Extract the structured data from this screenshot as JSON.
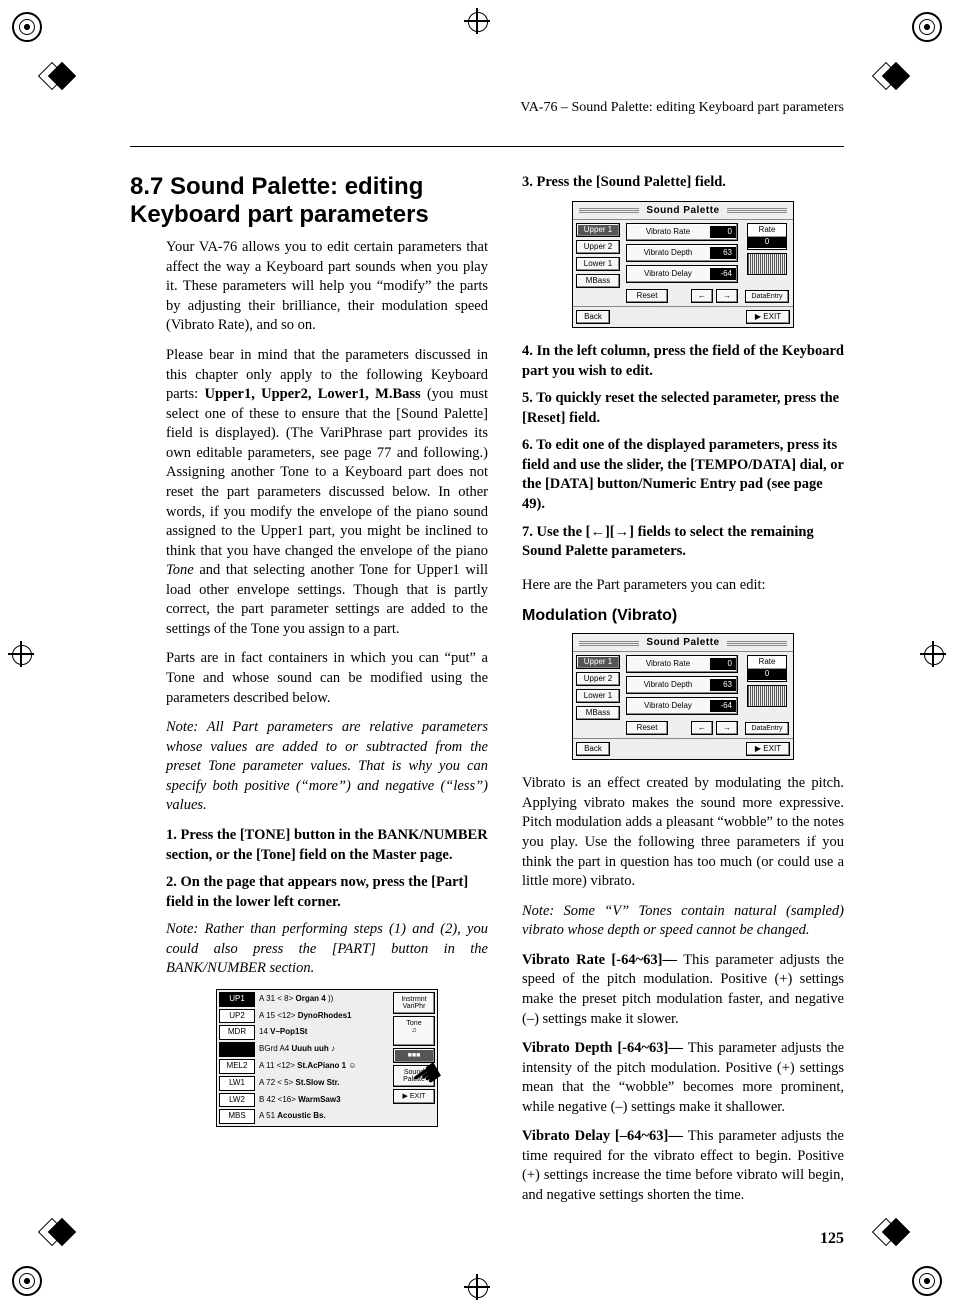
{
  "running_head": "VA-76 – Sound Palette: editing Keyboard part parameters",
  "page_number": "125",
  "heading": "8.7 Sound Palette: editing Keyboard part parameters",
  "para_intro": "Your VA-76 allows you to edit certain parameters that affect the way a Keyboard part sounds when you play it. These parameters will help you “modify” the parts by adjusting their brilliance, their modulation speed (Vibrato Rate), and so on.",
  "para_bear_pre": "Please bear in mind that the parameters discussed in this chapter only apply to the following Keyboard parts: ",
  "bold_parts": "Upper1, Upper2, Lower1, M.Bass",
  "para_bear_post": " (you must select one of these to ensure that the [Sound Palette] field is displayed). (The VariPhrase part provides its own editable parameters, see page 77 and following.) Assigning another Tone to a Keyboard part does not reset the part parameters discussed below. In other words, if you modify the envelope of the piano sound assigned to the Upper1 part, you might be inclined to think that you have changed the envelope of the piano ",
  "italic_tone": "Tone",
  "para_bear_post2": " and that selecting another Tone for Upper1 will load other envelope settings. Though that is partly correct, the part parameter settings are added to the settings of the Tone you assign to a part.",
  "para_parts": "Parts are in fact containers in which you can “put” a Tone and whose sound can be modified using the parameters described below.",
  "note_relative": "Note: All Part parameters are relative parameters whose values are added to or subtracted from the preset Tone parameter values. That is why you can specify both positive (“more”) and negative (“less”) values.",
  "step1": "1. Press the [TONE] button in the BANK/NUMBER section, or the [Tone] field on the Master page.",
  "step2": "2. On the page that appears now, press the [Part] field in the lower left corner.",
  "note_steps12": "Note: Rather than performing steps (1) and (2), you could also press the [PART] button in the BANK/NUMBER section.",
  "step3": "3. Press the [Sound Palette] field.",
  "step4": "4. In the left column, press the field of the Keyboard part you wish to edit.",
  "step5": "5. To quickly reset the selected parameter, press the [Reset] field.",
  "step6": "6. To edit one of the displayed parameters, press its field and use the slider, the [TEMPO/DATA] dial, or the [DATA] button/Numeric Entry pad (see page 49).",
  "step7_pre": "7. Use the [",
  "step7_mid": "][",
  "step7_post": "] fields to select the remaining Sound Palette parameters.",
  "left_arrow": "←",
  "right_arrow": "→",
  "para_here": "Here are the Part parameters you can edit:",
  "subhead_mod": "Modulation (Vibrato)",
  "para_vibrato": "Vibrato is an effect created by modulating the pitch. Applying vibrato makes the sound more expressive. Pitch modulation adds a pleasant “wobble” to the notes you play. Use the following three parameters if you think the part in question has too much (or could use a little more) vibrato.",
  "note_vtones": "Note: Some “V” Tones contain natural (sampled) vibrato whose depth or speed cannot be changed.",
  "vr_name": "Vibrato Rate [-64~63]— ",
  "vr_body": "This parameter adjusts the speed of the pitch modulation. Positive (+) settings make the preset pitch modulation faster, and negative (–) settings make it slower.",
  "vd_name": "Vibrato Depth [-64~63]— ",
  "vd_body": "This parameter adjusts the intensity of the pitch modulation. Positive (+) settings mean that the “wobble” becomes more prominent, while negative (–) settings make it shallower.",
  "vdel_name": "Vibrato Delay [–64~63]— ",
  "vdel_body": "This parameter adjusts the time required for the vibrato effect to begin. Positive (+) settings increase the time before vibrato will begin, and negative settings shorten the time.",
  "lcd": {
    "title": "Sound  Palette",
    "side": {
      "u1": "Upper 1",
      "u2": "Upper 2",
      "l1": "Lower 1",
      "mb": "MBass"
    },
    "params": {
      "rate_lbl": "Vibrato Rate",
      "rate_val": "0",
      "depth_lbl": "Vibrato Depth",
      "depth_val": "63",
      "delay_lbl": "Vibrato Delay",
      "delay_val": "-64"
    },
    "reset": "Reset",
    "left": "←",
    "right": "→",
    "rate_caption": "Rate",
    "rate_num": "0",
    "dataentry": "DataEntry",
    "back": "Back",
    "exit": "▶ EXIT"
  },
  "partlcd": {
    "rows": [
      {
        "tag": "UP1",
        "open": false,
        "pre": "A 31 < 8> ",
        "bold": "Organ 4",
        "beep": true
      },
      {
        "tag": "UP2",
        "open": true,
        "pre": "A 15 <12> ",
        "bold": "DynoRhodes1"
      },
      {
        "tag": "MDR",
        "open": true,
        "pre": "14        ",
        "bold": "V–Pop1St"
      },
      {
        "tag": " ",
        "open": false,
        "pre": "BGrd  A4 ",
        "bold": "Uuuh uuh  ♪"
      },
      {
        "tag": "MEL2",
        "open": true,
        "pre": "A 11 <12> ",
        "bold": "St.AcPiano 1  ☺"
      },
      {
        "tag": "LW1",
        "open": true,
        "pre": "A 72 < 5> ",
        "bold": "St.Slow Str."
      },
      {
        "tag": "LW2",
        "open": true,
        "pre": "B 42 <16> ",
        "bold": "WarmSaw3"
      },
      {
        "tag": "MBS",
        "open": true,
        "pre": "A 51       ",
        "bold": "Acoustic Bs."
      }
    ],
    "side": {
      "instr": "Instrmnt\nVariPhr",
      "tone": "Tone\n♫",
      "pal": "■■■",
      "sndpal": "Sound\nPalette",
      "exit": "▶ EXIT"
    }
  }
}
